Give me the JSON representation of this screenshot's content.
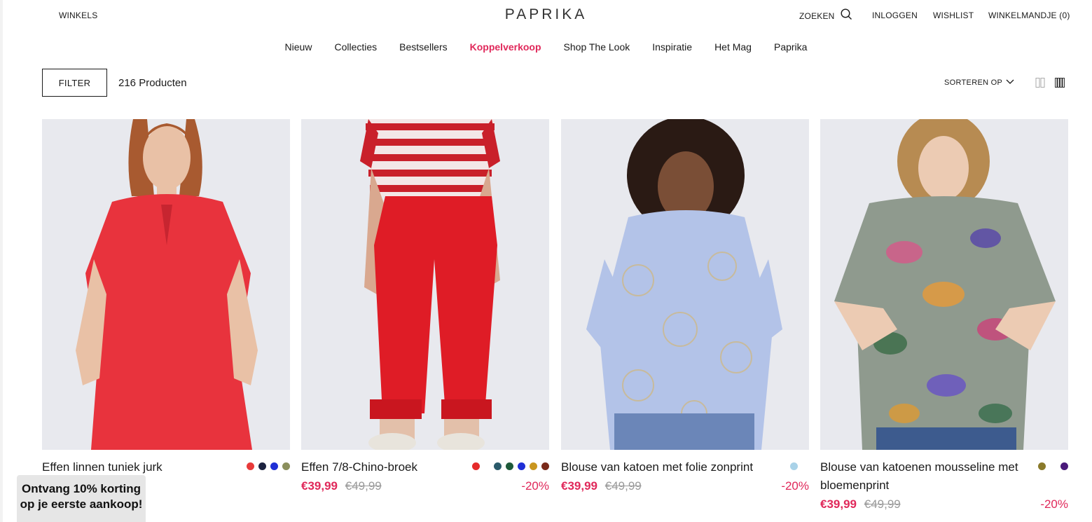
{
  "header": {
    "shops": "WINKELS",
    "logo": "PAPRIKA",
    "search": "ZOEKEN",
    "login": "INLOGGEN",
    "wishlist": "WISHLIST",
    "cart": "WINKELMANDJE (0)"
  },
  "nav": {
    "items": [
      {
        "label": "Nieuw",
        "active": false
      },
      {
        "label": "Collecties",
        "active": false
      },
      {
        "label": "Bestsellers",
        "active": false
      },
      {
        "label": "Koppelverkoop",
        "active": true
      },
      {
        "label": "Shop The Look",
        "active": false
      },
      {
        "label": "Inspiratie",
        "active": false
      },
      {
        "label": "Het Mag",
        "active": false
      },
      {
        "label": "Paprika",
        "active": false
      }
    ]
  },
  "toolbar": {
    "filter": "FILTER",
    "count": "216 Producten",
    "sort": "SORTEREN OP"
  },
  "products": [
    {
      "name": "Effen linnen tuniek jurk",
      "price": "",
      "old_price": "",
      "discount": "",
      "swatches": [
        "#e83a3a",
        "#1c2340",
        "#1f2fd6",
        "#8b8f5c"
      ]
    },
    {
      "name": "Effen 7/8-Chino-broek",
      "price": "€39,99",
      "old_price": "€49,99",
      "discount": "-20%",
      "swatches": [
        "#e52b2b",
        "#2a5a6a",
        "#1e5a3a",
        "#1f2fd6",
        "#c9961f",
        "#7a2a1a"
      ]
    },
    {
      "name": "Blouse van katoen met folie zonprint",
      "price": "€39,99",
      "old_price": "€49,99",
      "discount": "-20%",
      "swatches": [
        "#a9d2e8"
      ]
    },
    {
      "name": "Blouse van katoenen mousseline met bloemenprint",
      "price": "€39,99",
      "old_price": "€49,99",
      "discount": "-20%",
      "swatches": [
        "#8a7a2a",
        "#4a1a7a"
      ]
    }
  ],
  "promo": {
    "text": "Ontvang 10% korting op je eerste aankoop!"
  },
  "colors": {
    "accent": "#e0285a"
  }
}
